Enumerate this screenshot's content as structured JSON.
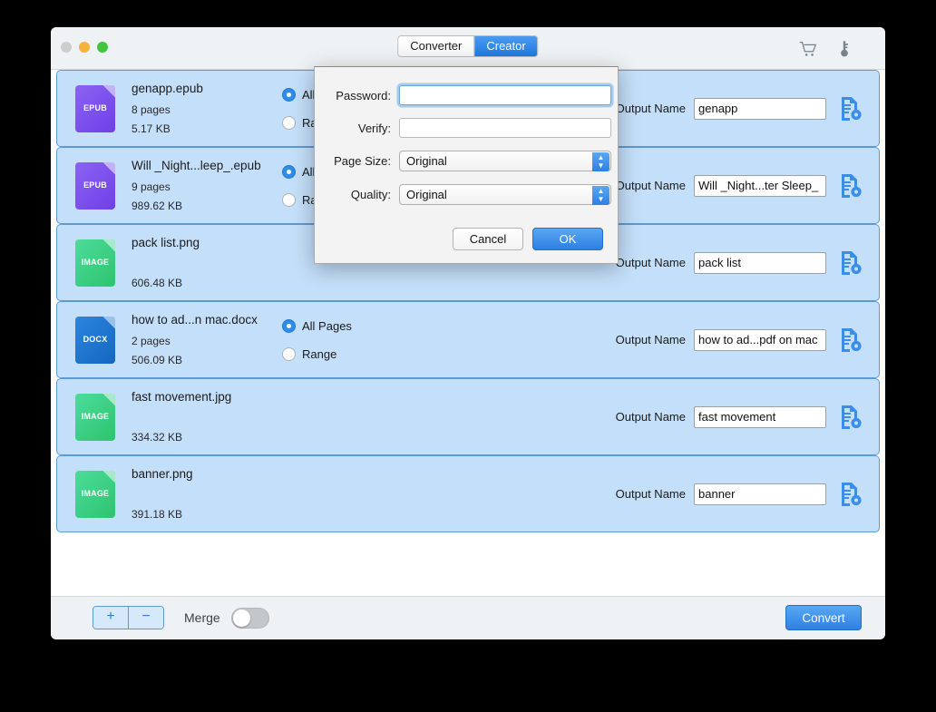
{
  "window": {
    "traffic_lights": [
      "close",
      "minimize",
      "maximize"
    ],
    "tabs": [
      {
        "label": "Converter",
        "active": false
      },
      {
        "label": "Creator",
        "active": true
      }
    ],
    "icons": [
      {
        "name": "cart-icon"
      },
      {
        "name": "key-icon"
      }
    ],
    "accent_color": "#2d80e4",
    "row_bg_color": "#c4dffa",
    "row_border_color": "#5c9ad6"
  },
  "files": [
    {
      "name": "genapp.epub",
      "pages": "8 pages",
      "size": "5.17 KB",
      "type": "EPUB",
      "icon_color": "#6f3fe8",
      "has_range": true,
      "range_options": [
        {
          "label": "All Pages",
          "selected": true
        },
        {
          "label": "Range",
          "selected": false
        }
      ],
      "output_label": "Output Name",
      "output_value": "genapp"
    },
    {
      "name": "Will _Night...leep_.epub",
      "pages": "9 pages",
      "size": "989.62 KB",
      "type": "EPUB",
      "icon_color": "#6f3fe8",
      "has_range": true,
      "range_options": [
        {
          "label": "All Pages",
          "selected": true
        },
        {
          "label": "Range",
          "selected": false
        }
      ],
      "output_label": "Output Name",
      "output_value": "Will _Night...ter Sleep_"
    },
    {
      "name": "pack list.png",
      "pages": "",
      "size": "606.48 KB",
      "type": "IMAGE",
      "icon_color": "#2cc46f",
      "has_range": false,
      "range_options": [],
      "output_label": "Output Name",
      "output_value": "pack list"
    },
    {
      "name": "how to ad...n mac.docx",
      "pages": "2 pages",
      "size": "506.09 KB",
      "type": "DOCX",
      "icon_color": "#1566c0",
      "has_range": true,
      "range_options": [
        {
          "label": "All Pages",
          "selected": true
        },
        {
          "label": "Range",
          "selected": false
        }
      ],
      "output_label": "Output Name",
      "output_value": "how to ad...pdf on mac"
    },
    {
      "name": "fast movement.jpg",
      "pages": "",
      "size": "334.32 KB",
      "type": "IMAGE",
      "icon_color": "#2cc46f",
      "has_range": false,
      "range_options": [],
      "output_label": "Output Name",
      "output_value": "fast movement"
    },
    {
      "name": "banner.png",
      "pages": "",
      "size": "391.18 KB",
      "type": "IMAGE",
      "icon_color": "#2cc46f",
      "has_range": false,
      "range_options": [],
      "output_label": "Output Name",
      "output_value": "banner"
    }
  ],
  "bottom_bar": {
    "add_label": "+",
    "remove_label": "−",
    "merge_label": "Merge",
    "merge_on": false,
    "convert_label": "Convert"
  },
  "dialog": {
    "fields": [
      {
        "label": "Password:",
        "value": "",
        "focused": true
      },
      {
        "label": "Verify:",
        "value": "",
        "focused": false
      }
    ],
    "selects": [
      {
        "label": "Page Size:",
        "value": "Original"
      },
      {
        "label": "Quality:",
        "value": "Original"
      }
    ],
    "cancel_label": "Cancel",
    "ok_label": "OK"
  }
}
